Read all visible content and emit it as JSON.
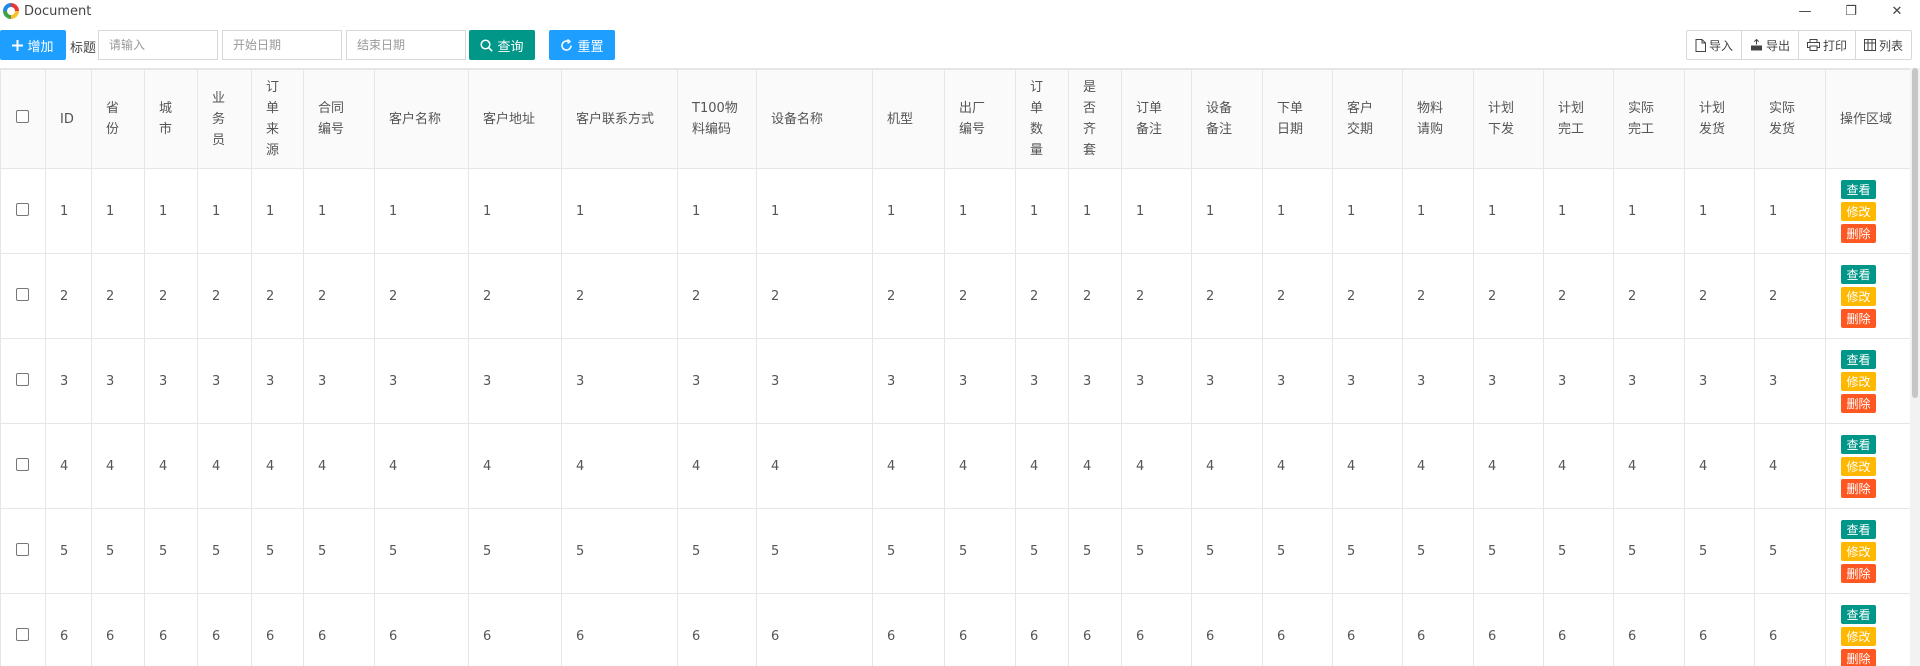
{
  "window": {
    "title": "Document",
    "minimize": "—",
    "restore": "❐",
    "close": "✕"
  },
  "toolbar": {
    "add_label": "增加",
    "title_label": "标题",
    "title_placeholder": "请输入",
    "start_placeholder": "开始日期",
    "end_placeholder": "结束日期",
    "query_label": "查询",
    "reset_label": "重置",
    "import_label": "导入",
    "export_label": "导出",
    "print_label": "打印",
    "columns_label": "列表"
  },
  "table": {
    "headers": [
      "ID",
      "省\n份",
      "城\n市",
      "业\n务\n员",
      "订\n单\n来\n源",
      "合同\n编号",
      "客户名称",
      "客户地址",
      "客户联系方式",
      "T100物\n料编码",
      "设备名称",
      "机型",
      "出厂\n编号",
      "订\n单\n数\n量",
      "是\n否\n齐\n套",
      "订单\n备注",
      "设备\n备注",
      "下单\n日期",
      "客户\n交期",
      "物料\n请购",
      "计划\n下发",
      "计划\n完工",
      "实际\n完工",
      "计划\n发货",
      "实际\n发货",
      "操作区域"
    ],
    "rows": [
      [
        "1",
        "1",
        "1",
        "1",
        "1",
        "1",
        "1",
        "1",
        "1",
        "1",
        "1",
        "1",
        "1",
        "1",
        "1",
        "1",
        "1",
        "1",
        "1",
        "1",
        "1",
        "1",
        "1",
        "1",
        "1"
      ],
      [
        "2",
        "2",
        "2",
        "2",
        "2",
        "2",
        "2",
        "2",
        "2",
        "2",
        "2",
        "2",
        "2",
        "2",
        "2",
        "2",
        "2",
        "2",
        "2",
        "2",
        "2",
        "2",
        "2",
        "2",
        "2"
      ],
      [
        "3",
        "3",
        "3",
        "3",
        "3",
        "3",
        "3",
        "3",
        "3",
        "3",
        "3",
        "3",
        "3",
        "3",
        "3",
        "3",
        "3",
        "3",
        "3",
        "3",
        "3",
        "3",
        "3",
        "3",
        "3"
      ],
      [
        "4",
        "4",
        "4",
        "4",
        "4",
        "4",
        "4",
        "4",
        "4",
        "4",
        "4",
        "4",
        "4",
        "4",
        "4",
        "4",
        "4",
        "4",
        "4",
        "4",
        "4",
        "4",
        "4",
        "4",
        "4"
      ],
      [
        "5",
        "5",
        "5",
        "5",
        "5",
        "5",
        "5",
        "5",
        "5",
        "5",
        "5",
        "5",
        "5",
        "5",
        "5",
        "5",
        "5",
        "5",
        "5",
        "5",
        "5",
        "5",
        "5",
        "5",
        "5"
      ],
      [
        "6",
        "6",
        "6",
        "6",
        "6",
        "6",
        "6",
        "6",
        "6",
        "6",
        "6",
        "6",
        "6",
        "6",
        "6",
        "6",
        "6",
        "6",
        "6",
        "6",
        "6",
        "6",
        "6",
        "6",
        "6"
      ]
    ],
    "actions": {
      "view": "查看",
      "edit": "修改",
      "delete": "删除"
    }
  },
  "colors": {
    "primary": "#1e9fff",
    "teal": "#009688",
    "warn": "#ffb800",
    "danger": "#ff5722"
  }
}
